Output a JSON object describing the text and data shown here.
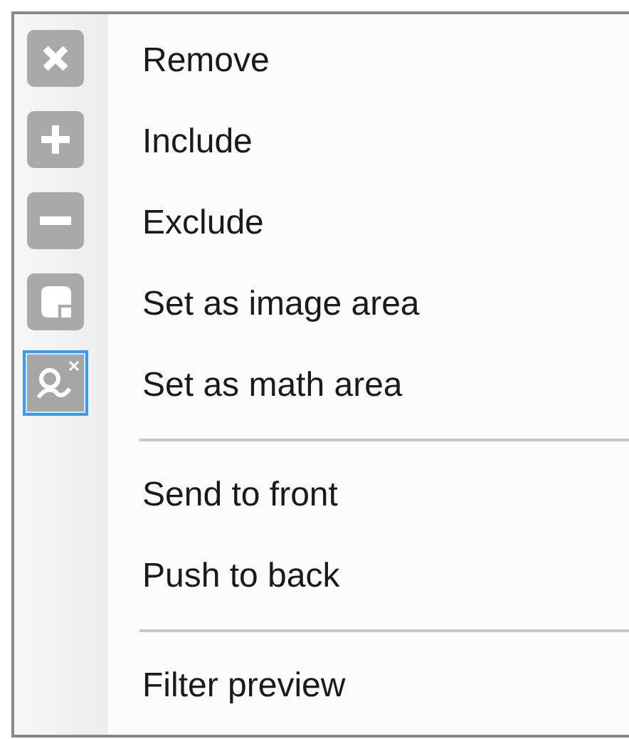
{
  "menu": {
    "items": [
      {
        "kind": "tool",
        "label": "Remove",
        "checked": false
      },
      {
        "kind": "tool",
        "label": "Include",
        "checked": false
      },
      {
        "kind": "tool",
        "label": "Exclude",
        "checked": false
      },
      {
        "kind": "tool",
        "label": "Set as image area",
        "checked": false
      },
      {
        "kind": "tool",
        "label": "Set as math area",
        "checked": true
      },
      {
        "kind": "separator"
      },
      {
        "kind": "item",
        "label": "Send to front"
      },
      {
        "kind": "item",
        "label": "Push to back"
      },
      {
        "kind": "separator"
      },
      {
        "kind": "item",
        "label": "Filter preview"
      }
    ]
  }
}
